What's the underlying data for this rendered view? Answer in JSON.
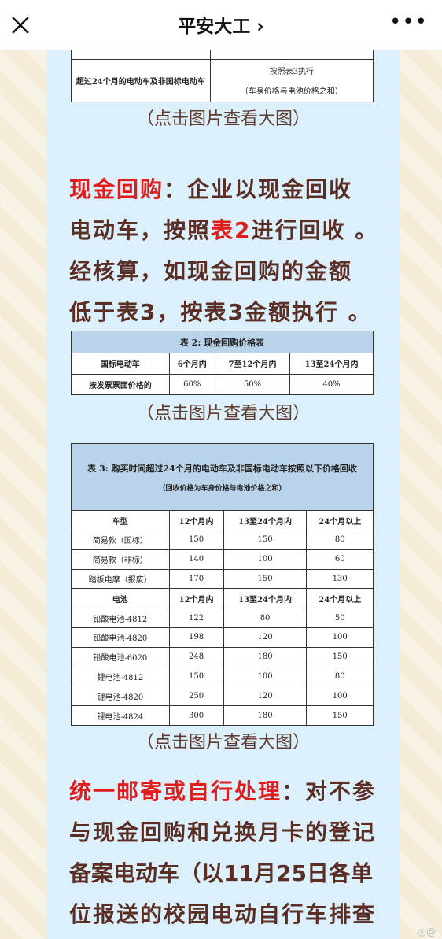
{
  "header": {
    "title": "平安大工 ›",
    "close_icon": "close-icon",
    "more_icon": "more-icon"
  },
  "table1": {
    "row_label": "超过24个月的电动车及非国标电动车",
    "value_line1": "按照表3执行",
    "value_line2": "（车身价格与电池价格之和）"
  },
  "caption": "（点击图片查看大图）",
  "para1": {
    "highlight": "现金回购",
    "lines": [
      "：企业以现金回收",
      "电动车，按照",
      "表2",
      "进行回收 。",
      "经核算，如现金回购的金额",
      "低于表3，按表3金额执行 。"
    ]
  },
  "table2": {
    "title": "表 2:  现金回购价格表",
    "headers": [
      "国标电动车",
      "6个月内",
      "7至12个月内",
      "13至24个月内"
    ],
    "row": [
      "按发票票面价格的",
      "60%",
      "50%",
      "40%"
    ]
  },
  "table3": {
    "title": "表 3:  购买时间超过24个月的电动车及非国标电动车按照以下价格回收",
    "subtitle": "（回收价格为车身价格与电池价格之和）",
    "headers1": [
      "车型",
      "12个月内",
      "13至24个月内",
      "24个月以上"
    ],
    "rows1": [
      [
        "简易款（国标）",
        "150",
        "150",
        "80"
      ],
      [
        "简易款（非标）",
        "140",
        "100",
        "60"
      ],
      [
        "踏板电摩（报废）",
        "170",
        "150",
        "130"
      ]
    ],
    "headers2": [
      "电池",
      "12个月内",
      "13至24个月内",
      "24个月以上"
    ],
    "rows2": [
      [
        "铅酸电池-4812",
        "122",
        "80",
        "50"
      ],
      [
        "铅酸电池-4820",
        "198",
        "120",
        "100"
      ],
      [
        "铅酸电池-6020",
        "248",
        "180",
        "150"
      ],
      [
        "锂电池-4812",
        "150",
        "100",
        "80"
      ],
      [
        "锂电池-4820",
        "250",
        "120",
        "100"
      ],
      [
        "锂电池-4824",
        "300",
        "180",
        "150"
      ]
    ]
  },
  "para2": {
    "highlight": "统一邮寄或自行处理",
    "lines": [
      "：对不参",
      "与现金回购和兑换月卡的登记",
      "备案电动车（以11月25日各单",
      "位报送的校园电动自行车排查"
    ]
  },
  "colors": {
    "accent_red": "#e21b1b",
    "text_brown": "#5a2e24",
    "panel_blue": "#dcf0fb",
    "table_header": "#b9d4ea"
  }
}
